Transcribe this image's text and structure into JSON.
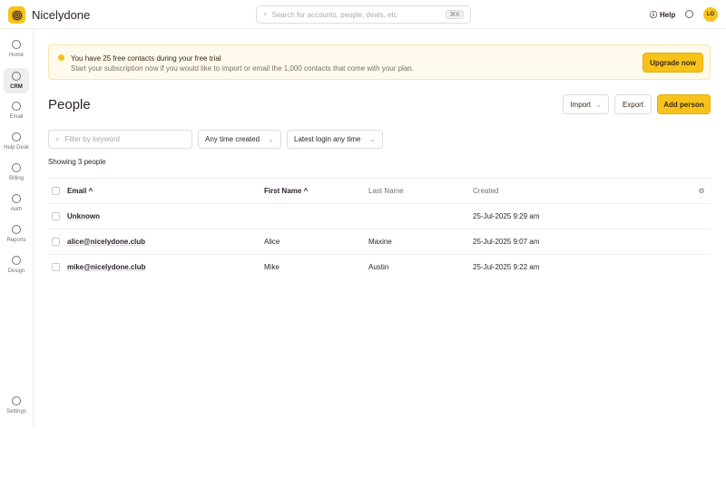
{
  "app": {
    "name": "Nicelydone"
  },
  "search": {
    "placeholder": "Search for accounts, people, deals, etc",
    "shortcut": "⌘K"
  },
  "header": {
    "help": "Help",
    "avatar": "LO"
  },
  "sidebar": {
    "items": [
      {
        "label": "Home"
      },
      {
        "label": "CRM"
      },
      {
        "label": "Email"
      },
      {
        "label": "Help Desk"
      },
      {
        "label": "Billing"
      },
      {
        "label": "Auth"
      },
      {
        "label": "Reports"
      },
      {
        "label": "Design"
      }
    ],
    "settings": "Settings"
  },
  "banner": {
    "title": "You have 25 free contacts during your free trial",
    "text": "Start your subscription now if you would like to import or email the 1,000 contacts that come with your plan.",
    "button": "Upgrade now"
  },
  "page": {
    "title": "People",
    "import": "Import",
    "export": "Export",
    "add": "Add person"
  },
  "filters": {
    "keyword_placeholder": "Filter by keyword",
    "created": "Any time created",
    "login": "Latest login any time"
  },
  "count": "Showing 3 people",
  "table": {
    "headers": [
      "Email ^",
      "First Name ^",
      "Last Name",
      "Created"
    ],
    "rows": [
      {
        "email": "Unknown",
        "first": "",
        "last": "",
        "created": "25-Jul-2025 9:29 am"
      },
      {
        "email": "alice@nicelydone.club",
        "first": "Alice",
        "last": "Maxine",
        "created": "25-Jul-2025 9:07 am"
      },
      {
        "email": "mike@nicelydone.club",
        "first": "Mike",
        "last": "Austin",
        "created": "25-Jul-2025 9:22 am"
      }
    ]
  }
}
